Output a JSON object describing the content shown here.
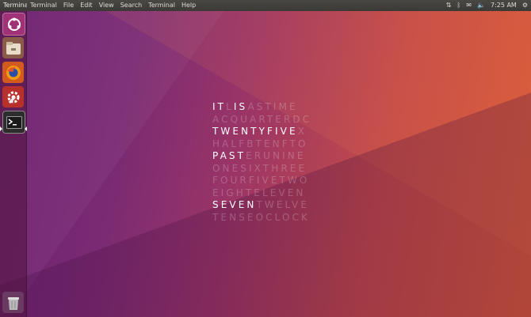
{
  "topbar": {
    "app_name": "Terminal",
    "menus": [
      "Terminal",
      "File",
      "Edit",
      "View",
      "Search",
      "Terminal",
      "Help"
    ],
    "time": "7:25 AM",
    "icons": [
      "network-icon",
      "bluetooth-icon",
      "mail-icon",
      "volume-icon",
      "gear-icon"
    ]
  },
  "launcher": {
    "items": [
      "dash-icon",
      "files-icon",
      "firefox-icon",
      "software-icon",
      "terminal-icon",
      "trash-icon"
    ]
  },
  "word_clock": {
    "rows": [
      [
        {
          "t": "IT",
          "on": true
        },
        {
          "t": "L",
          "on": false
        },
        {
          "t": "IS",
          "on": true
        },
        {
          "t": "ASTIME",
          "on": false
        }
      ],
      [
        {
          "t": "ACQUARTERDC",
          "on": false
        }
      ],
      [
        {
          "t": "TWENTYFIVE",
          "on": true
        },
        {
          "t": "X",
          "on": false
        }
      ],
      [
        {
          "t": "HALFBTENFTO",
          "on": false
        }
      ],
      [
        {
          "t": "PAST",
          "on": true
        },
        {
          "t": "ERUNINE",
          "on": false
        }
      ],
      [
        {
          "t": "ONESIXTHREE",
          "on": false
        }
      ],
      [
        {
          "t": "FOURFIVETWO",
          "on": false
        }
      ],
      [
        {
          "t": "EIGHTELEVEN",
          "on": false
        }
      ],
      [
        {
          "t": "SEVEN",
          "on": true
        },
        {
          "t": "TWELVE",
          "on": false
        }
      ],
      [
        {
          "t": "TENSEOCLOCK",
          "on": false
        }
      ]
    ]
  }
}
